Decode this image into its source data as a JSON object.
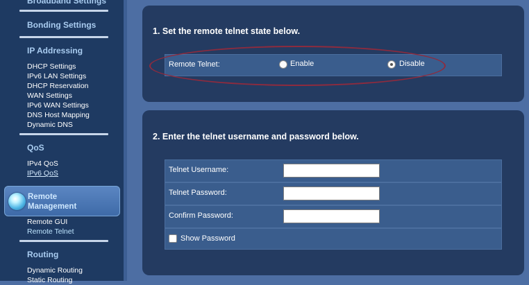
{
  "sidebar": {
    "broadband_cut": "Broadband Settings",
    "bonding": "Bonding Settings",
    "ip_addressing": {
      "title": "IP Addressing",
      "items": [
        "DHCP Settings",
        "IPv6 LAN Settings",
        "DHCP Reservation",
        "WAN Settings",
        "IPv6 WAN Settings",
        "DNS Host Mapping",
        "Dynamic DNS"
      ]
    },
    "qos": {
      "title": "QoS",
      "items": [
        "IPv4 QoS",
        "IPv6 QoS"
      ]
    },
    "remote_management": {
      "line1": "Remote",
      "line2": "Management",
      "items": [
        "Remote GUI",
        "Remote Telnet"
      ]
    },
    "routing": {
      "title": "Routing",
      "items": [
        "Dynamic Routing",
        "Static Routing"
      ]
    }
  },
  "panel1": {
    "heading": "1. Set the remote telnet state below.",
    "row_label": "Remote Telnet:",
    "options": [
      {
        "label": "Enable",
        "selected": false
      },
      {
        "label": "Disable",
        "selected": true
      }
    ]
  },
  "panel2": {
    "heading": "2. Enter the telnet username and password below.",
    "fields": [
      {
        "label": "Telnet Username:",
        "value": ""
      },
      {
        "label": "Telnet Password:",
        "value": ""
      },
      {
        "label": "Confirm Password:",
        "value": ""
      }
    ],
    "show_password_label": "Show Password",
    "show_password_checked": false
  },
  "colors": {
    "sidebar_bg": "#1e3a62",
    "panel_bg": "#243b61",
    "row_bg": "#3a5d8d",
    "highlight_ellipse": "#8e2b3e",
    "section_title": "#a9ccf0"
  }
}
